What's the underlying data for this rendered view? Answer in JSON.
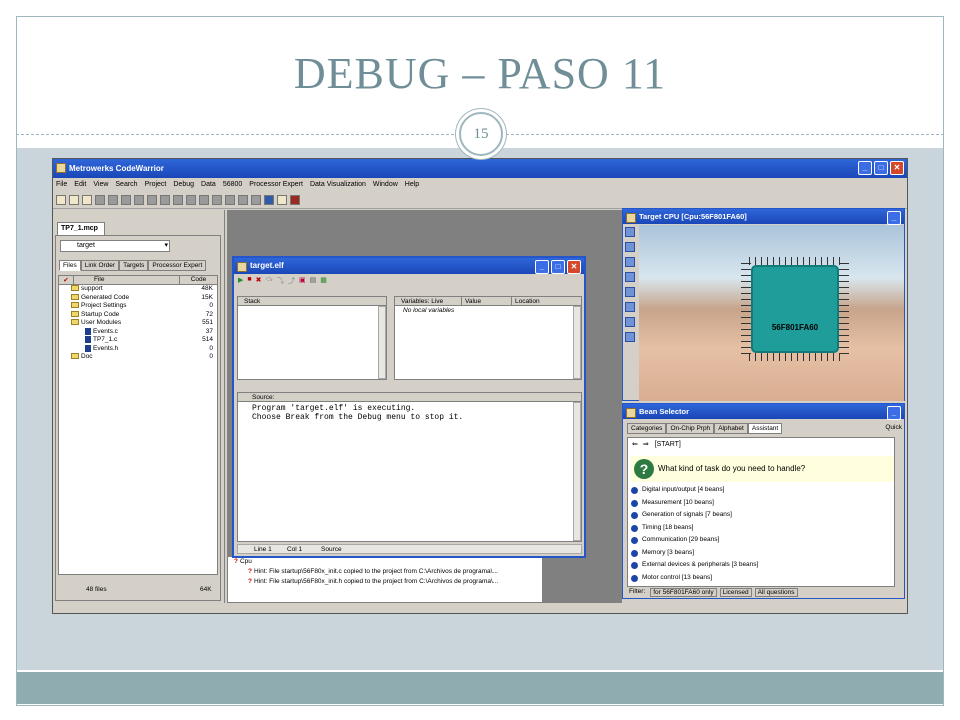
{
  "slide": {
    "title": "DEBUG – PASO 11",
    "page_number": "15"
  },
  "app": {
    "title": "Metrowerks CodeWarrior",
    "menu": [
      "File",
      "Edit",
      "View",
      "Search",
      "Project",
      "Debug",
      "Data",
      "56800",
      "Processor Expert",
      "Data Visualization",
      "Window",
      "Help"
    ],
    "project_tab": "TP7_1.mcp",
    "target_select": "target",
    "left_tabs": [
      "Files",
      "Link Order",
      "Targets",
      "Processor Expert"
    ],
    "file_headers": {
      "file": "File",
      "code": "Code"
    },
    "files": [
      {
        "name": "support",
        "code": "48K",
        "type": "folder",
        "indent": 0
      },
      {
        "name": "Generated Code",
        "code": "15K",
        "type": "folder",
        "indent": 0
      },
      {
        "name": "Project Settings",
        "code": "0",
        "type": "folder",
        "indent": 0
      },
      {
        "name": "Startup Code",
        "code": "72",
        "type": "folder",
        "indent": 0
      },
      {
        "name": "User Modules",
        "code": "551",
        "type": "folder",
        "indent": 0
      },
      {
        "name": "Events.c",
        "code": "37",
        "type": "file",
        "indent": 1
      },
      {
        "name": "TP7_1.c",
        "code": "514",
        "type": "file",
        "indent": 1
      },
      {
        "name": "Events.h",
        "code": "0",
        "type": "file",
        "indent": 1
      },
      {
        "name": "Doc",
        "code": "0",
        "type": "folder",
        "indent": 0
      }
    ],
    "files_count": "48 files",
    "files_total": "64K"
  },
  "debug_window": {
    "title": "target.elf",
    "stack_label": "Stack",
    "vars_label": "Variables: Live",
    "value_label": "Value",
    "location_label": "Location",
    "no_vars": "No local variables",
    "source_label": "Source:",
    "source_text": "Program 'target.elf' is executing.\nChoose Break from the Debug menu to stop it.",
    "status": {
      "line": "Line 1",
      "col": "Col 1",
      "mode": "Source"
    }
  },
  "output": {
    "rows": [
      "Cpu",
      "Hint: File startup\\56F80x_init.c copied to the project from C:\\Archivos de programa\\...",
      "Hint: File startup\\56F80x_init.h copied to the project from C:\\Archivos de programa\\..."
    ]
  },
  "cpu_window": {
    "title": "Target CPU [Cpu:56F801FA60]",
    "chip_label": "56F801FA60"
  },
  "bean_selector": {
    "title": "Bean Selector",
    "tabs": [
      "Categories",
      "On-Chip Prph",
      "Alphabet",
      "Assistant"
    ],
    "quick": "Quick",
    "nav": "[START]",
    "question": "What kind of task do you need to handle?",
    "items": [
      "Digital input/output  [4 beans]",
      "Measurement  [10 beans]",
      "Generation of signals  [7 beans]",
      "Timing  [18 beans]",
      "Communication  [29 beans]",
      "Memory  [3 beans]",
      "External devices & peripherals  [3 beans]",
      "Motor control  [13 beans]"
    ],
    "filter_label": "Filter:",
    "filter_value": "for 56F801FA60 only",
    "licensed": "Licensed",
    "all_questions": "All questions"
  }
}
